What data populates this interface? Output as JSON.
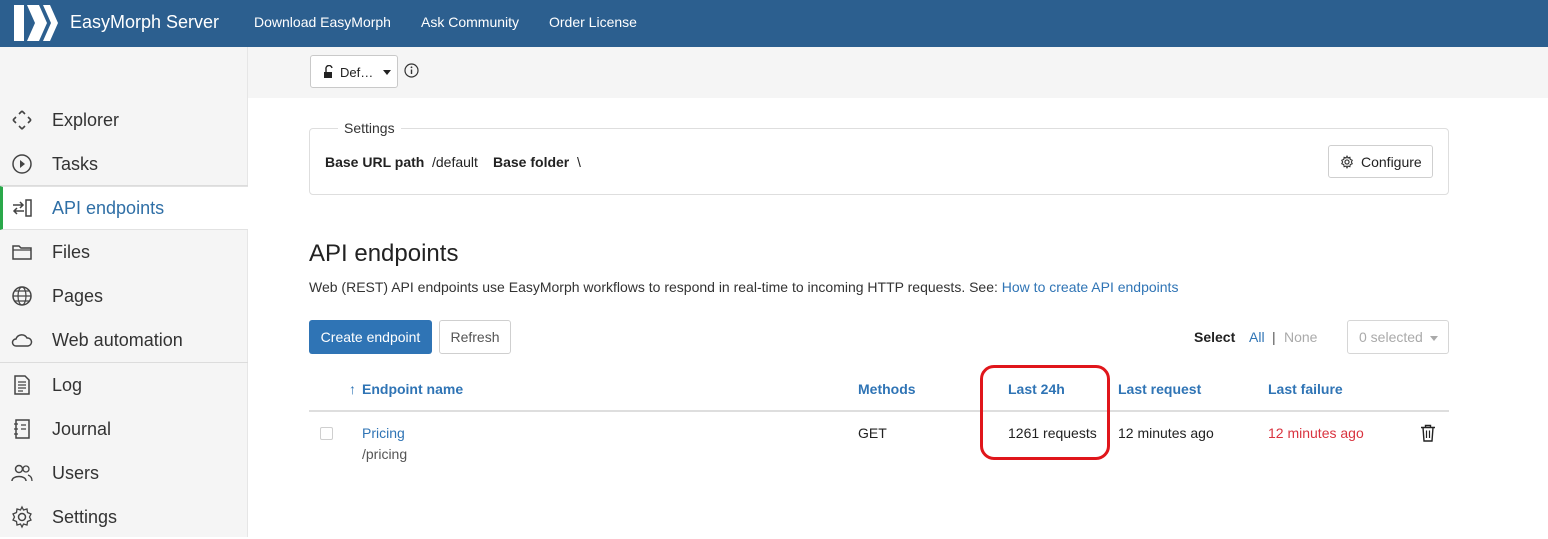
{
  "topbar": {
    "brand": "EasyMorph Server",
    "nav": [
      "Download EasyMorph",
      "Ask Community",
      "Order License"
    ]
  },
  "sidebar": {
    "items": [
      {
        "label": "Explorer",
        "icon": "explorer-icon"
      },
      {
        "label": "Tasks",
        "icon": "play-circle-icon"
      },
      {
        "label": "API endpoints",
        "icon": "api-arrows-icon",
        "active": true
      },
      {
        "label": "Files",
        "icon": "folder-icon"
      },
      {
        "label": "Pages",
        "icon": "globe-icon"
      },
      {
        "label": "Web automation",
        "icon": "cloud-icon"
      },
      {
        "label": "Log",
        "icon": "log-document-icon"
      },
      {
        "label": "Journal",
        "icon": "journal-notebook-icon"
      },
      {
        "label": "Users",
        "icon": "users-icon"
      },
      {
        "label": "Settings",
        "icon": "gear-icon"
      }
    ]
  },
  "workspace": {
    "label": "Def…",
    "icon": "lock-open-icon"
  },
  "settings": {
    "legend": "Settings",
    "base_url_label": "Base URL path",
    "base_url_value": "/default",
    "base_folder_label": "Base folder",
    "base_folder_value": "\\",
    "configure_label": "Configure"
  },
  "main": {
    "title": "API endpoints",
    "description": "Web (REST) API endpoints use EasyMorph workflows to respond in real-time to incoming HTTP requests. See: ",
    "link": "How to create API endpoints",
    "create_label": "Create endpoint",
    "refresh_label": "Refresh",
    "select_label": "Select",
    "select_all": "All",
    "select_sep": "|",
    "select_none": "None",
    "selected_dropdown": "0 selected"
  },
  "table": {
    "sort_arrow": "↑",
    "columns": [
      "Endpoint name",
      "Methods",
      "Last 24h",
      "Last request",
      "Last failure"
    ],
    "rows": [
      {
        "name": "Pricing",
        "path": "/pricing",
        "methods": "GET",
        "last24h": "1261 requests",
        "last_request": "12 minutes ago",
        "last_failure": "12 minutes ago"
      }
    ]
  },
  "colors": {
    "topbar": "#2c5f8f",
    "link": "#2f74b5",
    "active_marker": "#2aa84a",
    "failure": "#d9333f",
    "annotation": "#e0161b"
  }
}
